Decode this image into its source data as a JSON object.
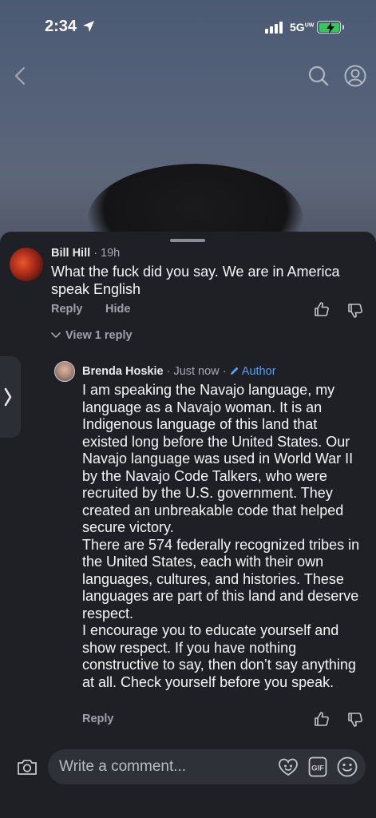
{
  "status_bar": {
    "time": "2:34",
    "network": "5G",
    "network_sub": "UW",
    "battery_state": "charging"
  },
  "top_bar": {
    "icons": [
      "chevron-left-icon",
      "search-icon",
      "profile-icon"
    ]
  },
  "comments": [
    {
      "author": "Bill Hill",
      "time": "19h",
      "body": "What the fuck did you say. We are in America speak English",
      "actions": {
        "reply": "Reply",
        "hide": "Hide"
      },
      "view_replies": "View 1 reply"
    },
    {
      "author": "Brenda Hoskie",
      "time": "Just now",
      "badge": "Author",
      "body": "I am speaking the Navajo language, my language as a Navajo woman. It is an Indigenous language of this land that existed long before the United States. Our Navajo language was used in World War II by the Navajo Code Talkers, who were recruited by the U.S. government. They created an unbreakable code that helped secure victory.\nThere are 574 federally recognized tribes in the United States, each with their own languages, cultures, and histories. These languages are part of this land and deserve respect.\nI encourage you to educate yourself and show respect. If you have nothing constructive to say, then don’t say anything at all. Check yourself before you speak.",
      "actions": {
        "reply": "Reply"
      }
    }
  ],
  "composer": {
    "placeholder": "Write a comment...",
    "gif_label": "GIF"
  },
  "colors": {
    "sheet_bg": "#1e2025",
    "author_badge": "#5aa0f0",
    "battery": "#35c759"
  }
}
